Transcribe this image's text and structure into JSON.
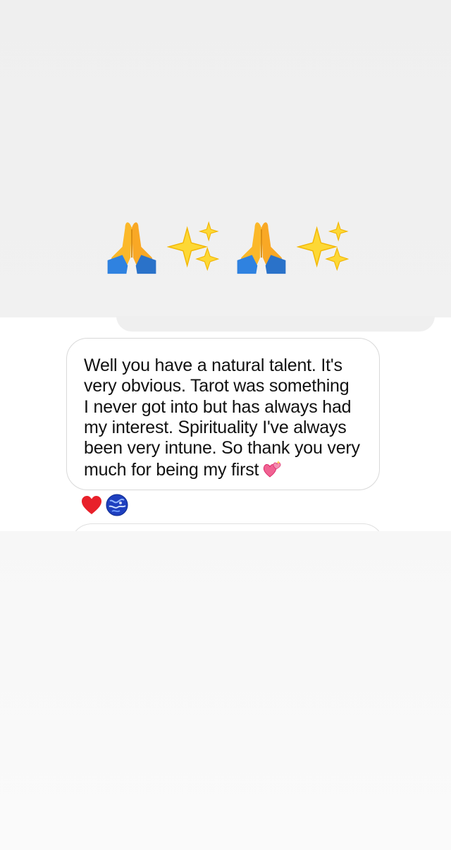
{
  "top_card": {
    "emojis": [
      "folded-hands-icon",
      "sparkles-icon",
      "folded-hands-icon",
      "sparkles-icon"
    ]
  },
  "message": {
    "text": "Well you have a natural talent. It's\nvery obvious. Tarot was something\nI never got into but has always had\nmy interest. Spirituality I've always\nbeen very intune. So thank you very\nmuch for being my first",
    "trailing_emoji": "two-hearts-icon"
  },
  "reactions": [
    "red-heart-icon",
    "blue-globe-avatar-icon"
  ],
  "colors": {
    "panel_gray": "#efefef",
    "bubble_border": "#d9d9d9",
    "text": "#111111",
    "heart_red": "#e8202a"
  }
}
